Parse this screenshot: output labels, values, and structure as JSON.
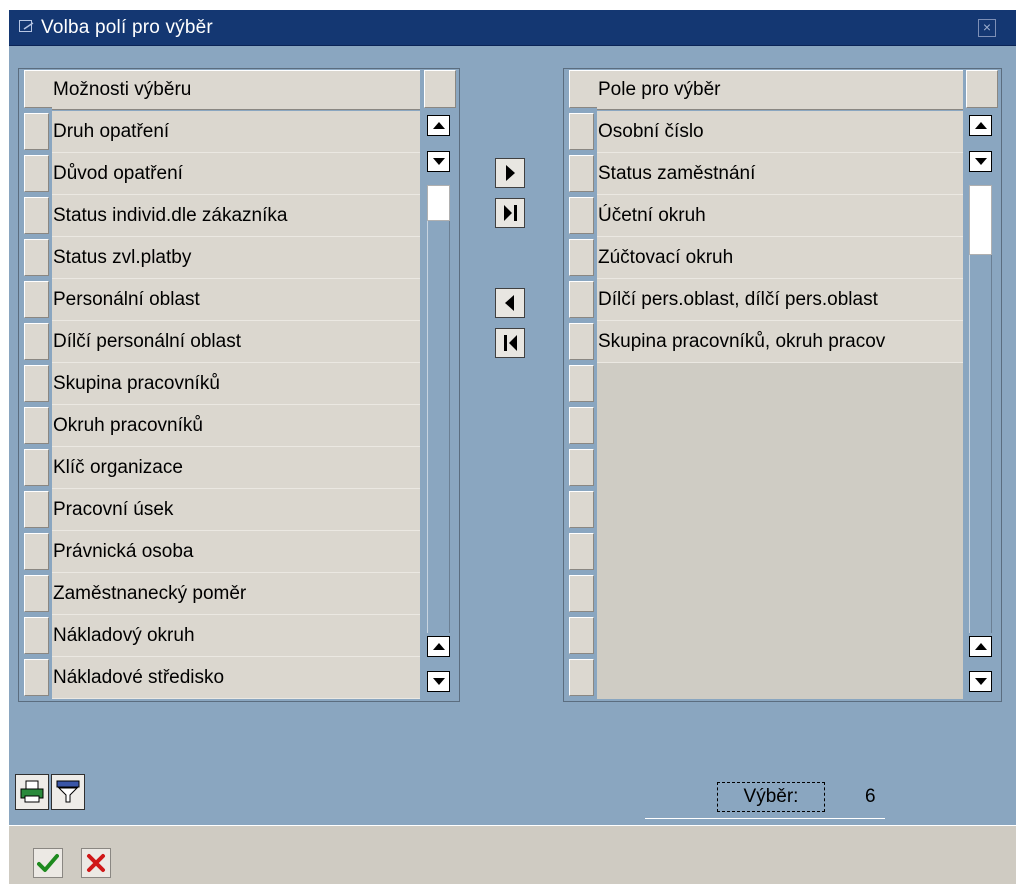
{
  "window": {
    "title": "Volba polí pro výběr",
    "colors": {
      "titlebar": "#143772",
      "background": "#8aa6c0",
      "cell": "#dbd7cf"
    }
  },
  "available": {
    "header": "Možnosti výběru",
    "items": [
      "Druh opatření",
      "Důvod opatření",
      "Status individ.dle zákazníka",
      "Status zvl.platby",
      "Personální oblast",
      "Dílčí personální oblast",
      "Skupina pracovníků",
      "Okruh pracovníků",
      "Klíč organizace",
      "Pracovní úsek",
      "Právnická osoba",
      "Zaměstnanecký poměr",
      "Nákladový okruh",
      "Nákladové středisko"
    ]
  },
  "selected": {
    "header": "Pole pro výběr",
    "items": [
      "Osobní číslo",
      "Status zaměstnání",
      "Účetní okruh",
      "Zúčtovací okruh",
      "Dílčí pers.oblast, dílčí pers.oblast",
      "Skupina pracovníků, okruh pracov"
    ]
  },
  "transfer_buttons": {
    "icons": [
      "move-right-icon",
      "move-all-right-icon",
      "move-left-icon",
      "move-all-left-icon"
    ]
  },
  "tools": {
    "icons": [
      "print-icon",
      "filter-icon"
    ]
  },
  "selection": {
    "label": "Výběr:",
    "count": "6"
  },
  "footer": {
    "icons": [
      "confirm-check-icon",
      "cancel-x-icon"
    ]
  }
}
